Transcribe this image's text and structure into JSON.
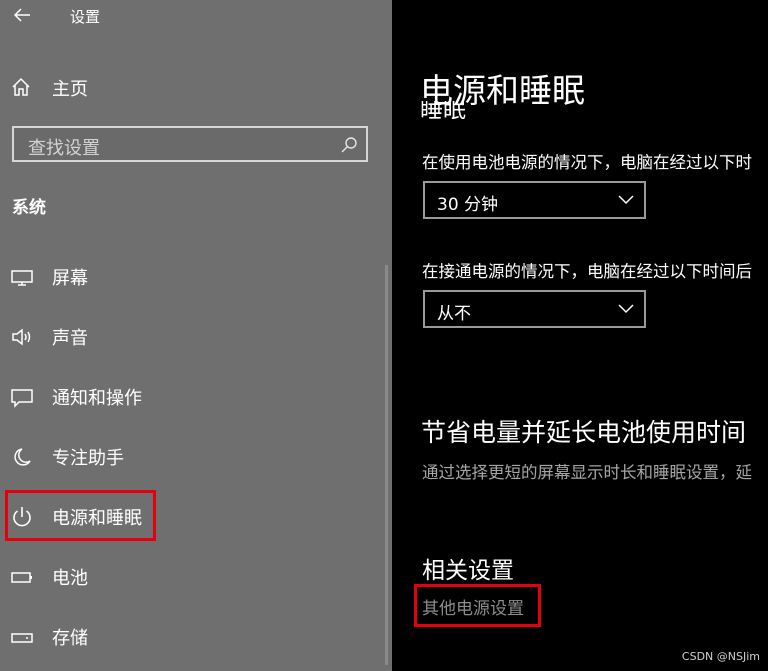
{
  "app": {
    "title": "设置"
  },
  "sidebar": {
    "home_label": "主页",
    "search_placeholder": "查找设置",
    "section_title": "系统",
    "items": [
      {
        "label": "屏幕",
        "icon": "display-icon"
      },
      {
        "label": "声音",
        "icon": "speaker-icon"
      },
      {
        "label": "通知和操作",
        "icon": "notification-icon"
      },
      {
        "label": "专注助手",
        "icon": "moon-icon"
      },
      {
        "label": "电源和睡眠",
        "icon": "power-icon",
        "selected": true
      },
      {
        "label": "电池",
        "icon": "battery-icon"
      },
      {
        "label": "存储",
        "icon": "storage-icon"
      }
    ]
  },
  "main": {
    "page_title": "电源和睡眠",
    "partial_heading": "睡眠",
    "battery_desc": "在使用电池电源的情况下，电脑在经过以下时",
    "battery_value": "30 分钟",
    "plugged_desc": "在接通电源的情况下，电脑在经过以下时间后",
    "plugged_value": "从不",
    "save_title": "节省电量并延长电池使用时间",
    "save_desc": "通过选择更短的屏幕显示时长和睡眠设置，延",
    "related_title": "相关设置",
    "related_link": "其他电源设置"
  },
  "watermark": "CSDN @NSJim",
  "colors": {
    "sidebar_bg": "#6f6f6f",
    "main_bg": "#000000",
    "highlight": "#e3000f"
  }
}
